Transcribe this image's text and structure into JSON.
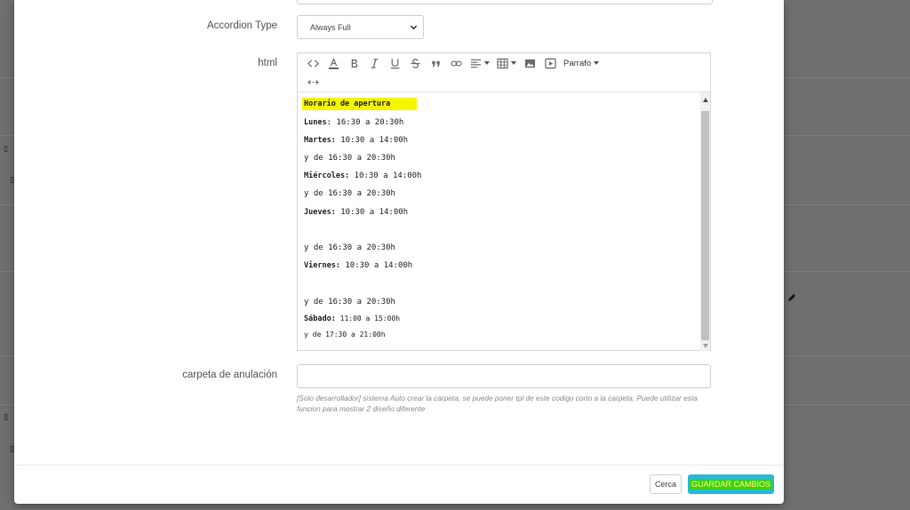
{
  "form": {
    "accordion_type_label": "Accordion Type",
    "accordion_type_value": "Always Full",
    "html_label": "html",
    "override_folder_label": "carpeta de anulación",
    "override_folder_value": "",
    "override_folder_help": "[Solo desarrollador] sistema Auto crear la carpeta, se puede poner tpl de este codigo corto a la carpeta. Puede utilizar esta funcion para mostrar 2 diseño diferente"
  },
  "toolbar": {
    "paragraph_label": "Parrafo",
    "icons": [
      "code-view-icon",
      "text-color-icon",
      "bold-icon",
      "italic-icon",
      "underline-icon",
      "strikethrough-icon",
      "quote-icon",
      "link-icon",
      "align-icon",
      "table-icon",
      "image-icon",
      "video-icon",
      "fullscreen-icon"
    ]
  },
  "editor_lines": [
    {
      "bold": "Horario de apertura",
      "text": ""
    },
    {
      "bold": "Lunes",
      "text": ": 16:30 a 20:30h"
    },
    {
      "bold": "Martes:",
      "text": " 10:30 a 14:00h"
    },
    {
      "bold": "",
      "text": "y de 16:30 a 20:30h"
    },
    {
      "bold": "Miércoles:",
      "text": " 10:30 a 14:00h"
    },
    {
      "bold": "",
      "text": "y de 16:30 a 20:30h"
    },
    {
      "bold": "Jueves:",
      "text": " 10:30 a 14:00h"
    },
    {
      "bold": "",
      "text": "y de 16:30 a 20:30h"
    },
    {
      "bold": "Viernes:",
      "text": " 10:30 a 14:00h"
    },
    {
      "bold": "",
      "text": "y de 16:30 a 20:30h"
    },
    {
      "bold": "Sábado:",
      "text": " 11:00 a 15:00h"
    },
    {
      "bold": "",
      "text": "y de 17:30 a 21:00h"
    }
  ],
  "footer": {
    "close_label": "Cerca",
    "save_label": "Guardar cambios"
  },
  "colors": {
    "save_button": "#25b9d7",
    "highlight": "#f5f500",
    "save_text_highlight": "#39d11b"
  }
}
